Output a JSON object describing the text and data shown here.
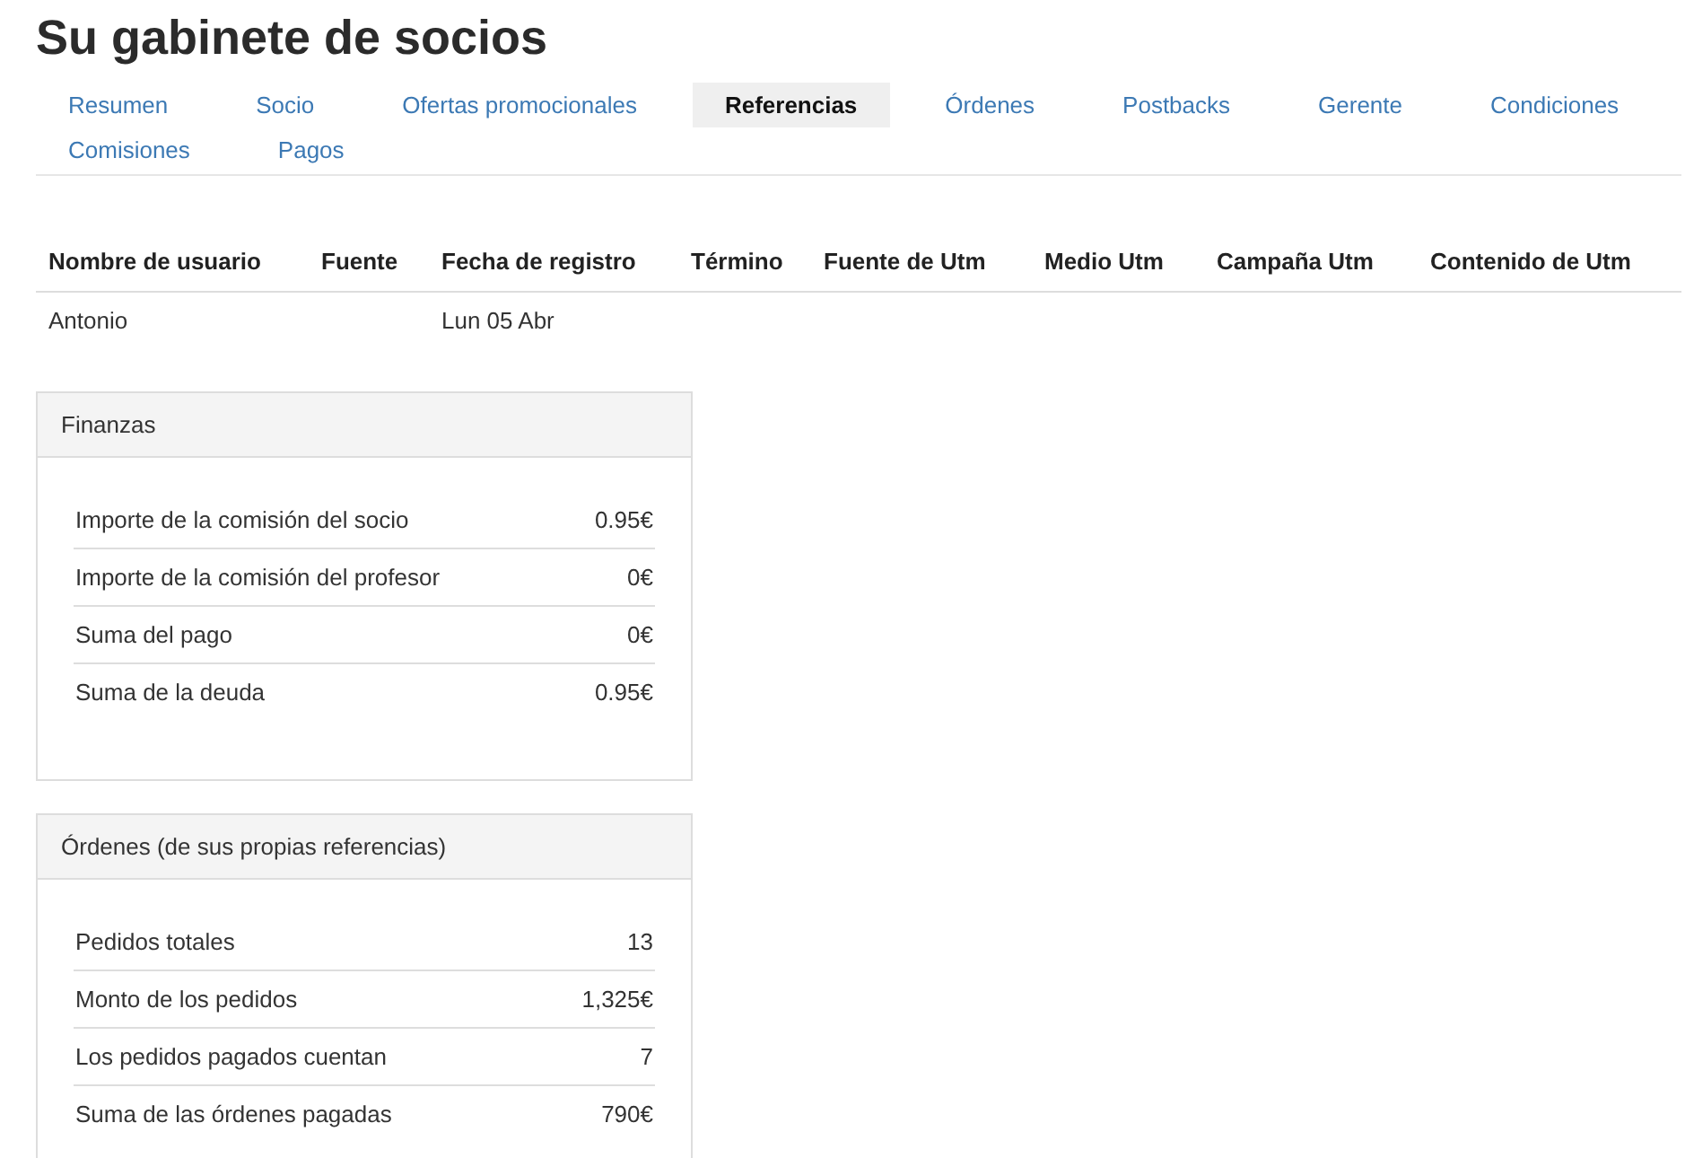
{
  "title": "Su gabinete de socios",
  "tabs": [
    {
      "label": "Resumen",
      "selected": false
    },
    {
      "label": "Socio",
      "selected": false
    },
    {
      "label": "Ofertas promocionales",
      "selected": false
    },
    {
      "label": "Referencias",
      "selected": true
    },
    {
      "label": "Órdenes",
      "selected": false
    },
    {
      "label": "Postbacks",
      "selected": false
    },
    {
      "label": "Gerente",
      "selected": false
    },
    {
      "label": "Condiciones",
      "selected": false
    },
    {
      "label": "Comisiones",
      "selected": false
    },
    {
      "label": "Pagos",
      "selected": false
    }
  ],
  "table": {
    "columns": [
      "Nombre de usuario",
      "Fuente",
      "Fecha de registro",
      "Término",
      "Fuente de Utm",
      "Medio Utm",
      "Campaña Utm",
      "Contenido de Utm"
    ],
    "rows": [
      [
        "Antonio",
        "",
        "Lun 05 Abr",
        "",
        "",
        "",
        "",
        ""
      ]
    ]
  },
  "panels": [
    {
      "title": "Finanzas",
      "rows": [
        {
          "label": "Importe de la comisión del socio",
          "value": "0.95€"
        },
        {
          "label": "Importe de la comisión del profesor",
          "value": "0€"
        },
        {
          "label": "Suma del pago",
          "value": "0€"
        },
        {
          "label": "Suma de la deuda",
          "value": "0.95€"
        }
      ]
    },
    {
      "title": "Órdenes (de sus propias referencias)",
      "rows": [
        {
          "label": "Pedidos totales",
          "value": "13"
        },
        {
          "label": "Monto de los pedidos",
          "value": "1,325€"
        },
        {
          "label": "Los pedidos pagados cuentan",
          "value": "7"
        },
        {
          "label": "Suma de las órdenes pagadas",
          "value": "790€"
        }
      ]
    }
  ]
}
